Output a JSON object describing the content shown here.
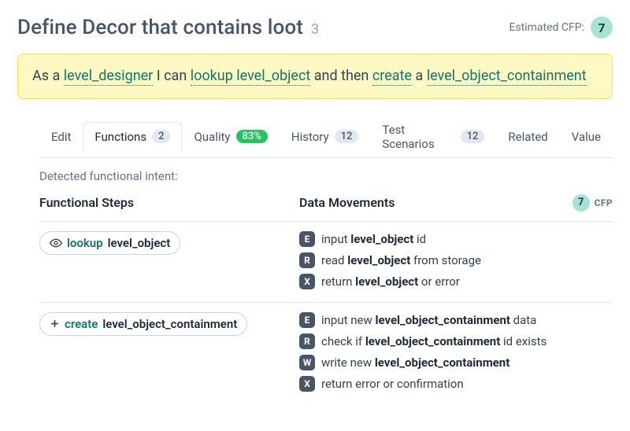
{
  "header": {
    "title": "Define Decor that contains loot",
    "title_count": "3",
    "cfp_label": "Estimated CFP:",
    "cfp_value": "7"
  },
  "story": {
    "t0": "As a ",
    "role": "level_designer",
    "t1": " I can ",
    "action1": "lookup level_object",
    "t2": " and then ",
    "action2": "create",
    "t3": " a ",
    "object": "level_object_containment"
  },
  "tabs": {
    "edit": "Edit",
    "functions": "Functions",
    "functions_count": "2",
    "quality": "Quality",
    "quality_pct": "83%",
    "history": "History",
    "history_count": "12",
    "scenarios": "Test Scenarios",
    "scenarios_count": "12",
    "related": "Related",
    "value": "Value"
  },
  "detected_label": "Detected functional intent:",
  "columns": {
    "steps": "Functional Steps",
    "movements": "Data Movements",
    "cfp_value": "7",
    "cfp_label": "CFP"
  },
  "steps": [
    {
      "verb": "lookup",
      "object": "level_object",
      "icon": "eye-icon",
      "movements": [
        {
          "badge": "E",
          "pre": "input ",
          "bold": "level_object",
          "post": " id"
        },
        {
          "badge": "R",
          "pre": "read ",
          "bold": "level_object",
          "post": " from storage"
        },
        {
          "badge": "X",
          "pre": "return ",
          "bold": "level_object",
          "post": " or error"
        }
      ]
    },
    {
      "verb": "create",
      "object": "level_object_containment",
      "icon": "plus-icon",
      "movements": [
        {
          "badge": "E",
          "pre": "input new ",
          "bold": "level_object_containment",
          "post": " data"
        },
        {
          "badge": "R",
          "pre": "check if ",
          "bold": "level_object_containment",
          "post": " id exists"
        },
        {
          "badge": "W",
          "pre": "write new ",
          "bold": "level_object_containment",
          "post": ""
        },
        {
          "badge": "X",
          "pre": "return error or confirmation",
          "bold": "",
          "post": ""
        }
      ]
    }
  ]
}
